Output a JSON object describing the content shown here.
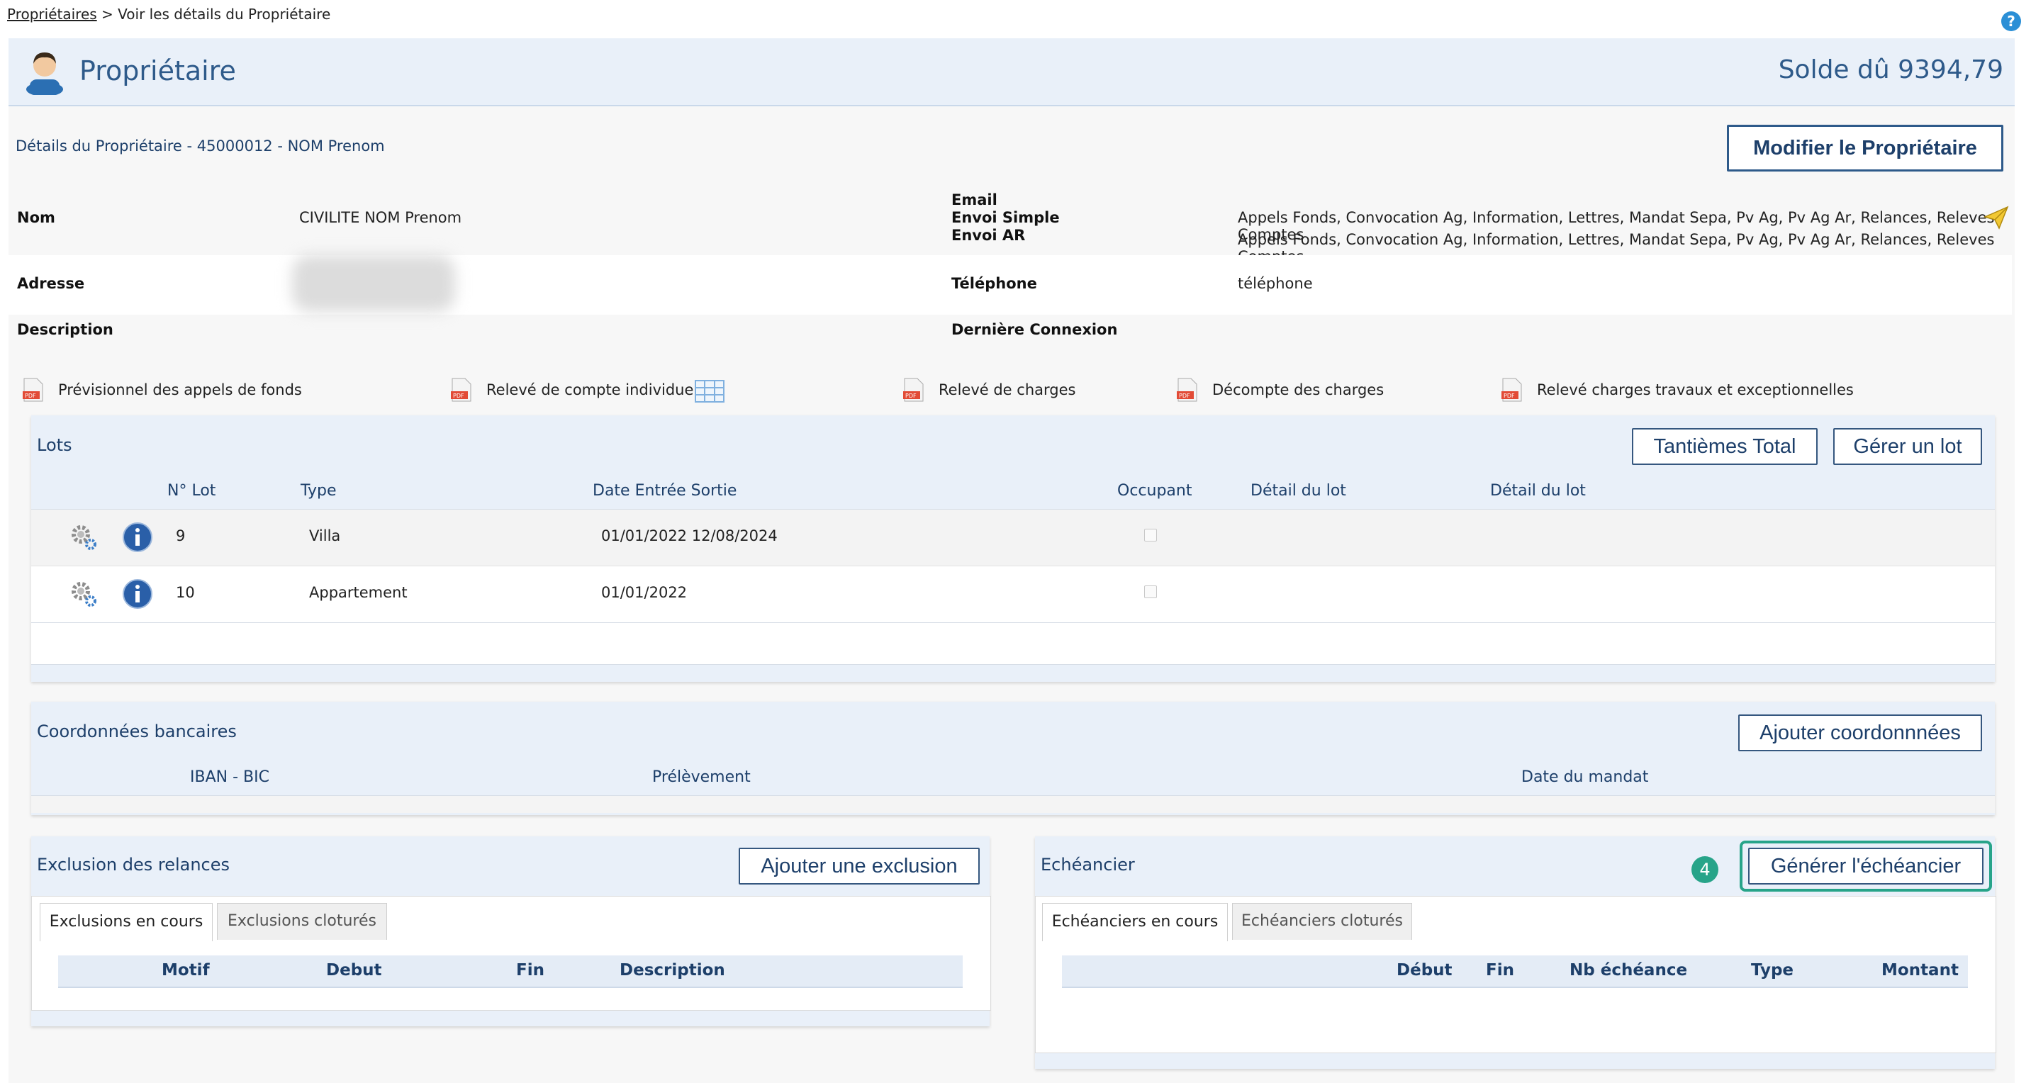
{
  "breadcrumb": {
    "link": "Propriétaires",
    "separator": " > ",
    "current": "Voir les détails du Propriétaire"
  },
  "header": {
    "title": "Propriétaire",
    "solde": "Solde dû 9394,79"
  },
  "details": {
    "label": "Détails du Propriétaire - 45000012 - NOM Prenom",
    "modify_button": "Modifier le Propriétaire",
    "nom_label": "Nom",
    "nom_value": "CIVILITE NOM Prenom",
    "email_label": "Email",
    "envoi_simple_label": "Envoi Simple",
    "envoi_ar_label": "Envoi AR",
    "envoi_simple_value": "Appels Fonds, Convocation Ag, Information, Lettres, Mandat Sepa, Pv Ag, Pv Ag Ar, Relances, Releves Comptes",
    "envoi_ar_value": "Appels Fonds, Convocation Ag, Information, Lettres, Mandat Sepa, Pv Ag, Pv Ag Ar, Relances, Releves Comptes",
    "adresse_label": "Adresse",
    "telephone_label": "Téléphone",
    "telephone_value": "téléphone",
    "description_label": "Description",
    "derniere_connexion_label": "Dernière Connexion"
  },
  "documents": [
    "Prévisionnel des appels de fonds",
    "Relevé de compte individuel",
    "Relevé de charges",
    "Décompte des charges",
    "Relevé charges travaux et exceptionnelles"
  ],
  "lots": {
    "title": "Lots",
    "btn_tantiemes": "Tantièmes Total",
    "btn_gerer": "Gérer un lot",
    "columns": [
      "N° Lot",
      "Type",
      "Date Entrée Sortie",
      "Occupant",
      "Détail du lot",
      "Détail du lot"
    ],
    "rows": [
      {
        "num": "9",
        "type": "Villa",
        "dates": "01/01/2022 12/08/2024"
      },
      {
        "num": "10",
        "type": "Appartement",
        "dates": "01/01/2022"
      }
    ]
  },
  "bank": {
    "title": "Coordonnées bancaires",
    "btn_add": "Ajouter coordonnnées",
    "columns": [
      "IBAN - BIC",
      "Prélèvement",
      "Date du mandat"
    ]
  },
  "exclusion": {
    "title": "Exclusion des relances",
    "btn_add": "Ajouter une exclusion",
    "tab_active": "Exclusions en cours",
    "tab_inactive": "Exclusions cloturés",
    "columns": [
      "Motif",
      "Debut",
      "Fin",
      "Description"
    ]
  },
  "echeancier": {
    "title": "Echéancier",
    "badge": "4",
    "btn_generate": "Générer l'échéancier",
    "tab_active": "Echéanciers en cours",
    "tab_inactive": "Echéanciers cloturés",
    "columns": [
      "Début",
      "Fin",
      "Nb échéance",
      "Type",
      "Montant"
    ]
  }
}
